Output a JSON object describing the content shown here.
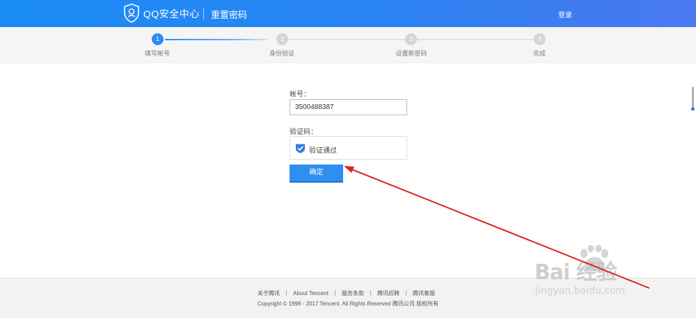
{
  "header": {
    "app_title": "QQ安全中心",
    "page_title": "重置密码",
    "login_label": "登录"
  },
  "steps": [
    {
      "number": "1",
      "label": "填写帐号",
      "active": true
    },
    {
      "number": "2",
      "label": "身份验证",
      "active": false
    },
    {
      "number": "3",
      "label": "设置新密码",
      "active": false
    },
    {
      "number": "4",
      "label": "完成",
      "active": false
    }
  ],
  "form": {
    "account_label": "帐号：",
    "account_value": "3500488387",
    "captcha_label": "验证码：",
    "captcha_status": "验证通过",
    "confirm_label": "确定"
  },
  "footer": {
    "links": [
      "关于腾讯",
      "About Tencent",
      "服务条款",
      "腾讯招聘",
      "腾讯客服"
    ],
    "copyright": "Copyright © 1998 - 2017 Tencent. All Rights Reserved 腾讯公司 版权所有"
  },
  "watermark": {
    "brand": "Bai 经验",
    "url": "jingyan.baidu.com"
  },
  "colors": {
    "header_blue": "#2a83f2",
    "active_step": "#2d8cf0",
    "button_blue": "#2f8ff0",
    "annotation_arrow": "#e0201e"
  }
}
